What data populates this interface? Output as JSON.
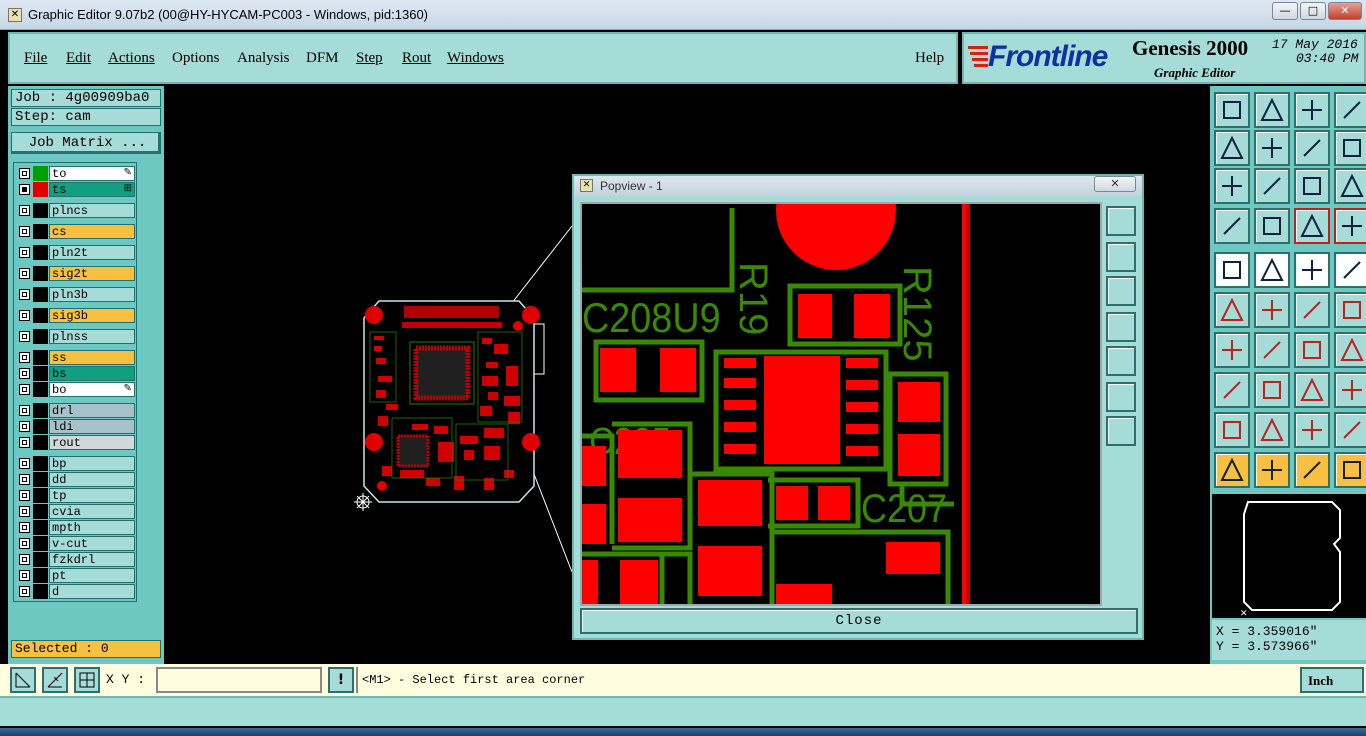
{
  "window": {
    "title": "Graphic Editor 9.07b2 (00@HY-HYCAM-PC003 - Windows, pid:1360)",
    "min": "—",
    "max": "□",
    "close": "✕"
  },
  "menu": [
    "File",
    "Edit",
    "Actions",
    "Options",
    "Analysis",
    "DFM",
    "Step",
    "Rout",
    "Windows"
  ],
  "help": "Help",
  "logo": {
    "brand": "Frontline",
    "product": "Genesis 2000",
    "sub": "Graphic Editor",
    "date": "17 May 2016",
    "time": "03:40 PM"
  },
  "job": {
    "job": "Job : 4g00909ba0",
    "step": "Step: cam",
    "matrix": "Job Matrix ..."
  },
  "layers": [
    {
      "name": "to",
      "color": "#00a000",
      "bg": "#ffffff",
      "checked": false,
      "mark": "✎"
    },
    {
      "name": "ts",
      "color": "#e00000",
      "bg": "#10a080",
      "checked": true,
      "mark": "⊞"
    },
    {
      "name": "plncs",
      "color": "#000000",
      "bg": "#a6dcd8",
      "checked": false,
      "mark": ""
    },
    {
      "name": "cs",
      "color": "#000000",
      "bg": "#f8c040",
      "checked": false,
      "mark": ""
    },
    {
      "name": "pln2t",
      "color": "#000000",
      "bg": "#a6dcd8",
      "checked": false,
      "mark": ""
    },
    {
      "name": "sig2t",
      "color": "#000000",
      "bg": "#f8c040",
      "checked": false,
      "mark": ""
    },
    {
      "name": "pln3b",
      "color": "#000000",
      "bg": "#a6dcd8",
      "checked": false,
      "mark": ""
    },
    {
      "name": "sig3b",
      "color": "#000000",
      "bg": "#f8c040",
      "checked": false,
      "mark": ""
    },
    {
      "name": "plnss",
      "color": "#000000",
      "bg": "#a6dcd8",
      "checked": false,
      "mark": ""
    },
    {
      "name": "ss",
      "color": "#000000",
      "bg": "#f8c040",
      "checked": false,
      "mark": ""
    },
    {
      "name": "bs",
      "color": "#000000",
      "bg": "#10a080",
      "checked": false,
      "mark": ""
    },
    {
      "name": "bo",
      "color": "#000000",
      "bg": "#ffffff",
      "checked": false,
      "mark": "✎"
    },
    {
      "name": "drl",
      "color": "#000000",
      "bg": "#a8c0c8",
      "checked": false,
      "mark": ""
    },
    {
      "name": "ldi",
      "color": "#000000",
      "bg": "#a8c0c8",
      "checked": false,
      "mark": ""
    },
    {
      "name": "rout",
      "color": "#000000",
      "bg": "#d0d8d8",
      "checked": false,
      "mark": ""
    },
    {
      "name": "bp",
      "color": "#000000",
      "bg": "#a6dcd8",
      "checked": false,
      "mark": ""
    },
    {
      "name": "dd",
      "color": "#000000",
      "bg": "#a6dcd8",
      "checked": false,
      "mark": ""
    },
    {
      "name": "tp",
      "color": "#000000",
      "bg": "#a6dcd8",
      "checked": false,
      "mark": ""
    },
    {
      "name": "cvia",
      "color": "#000000",
      "bg": "#a6dcd8",
      "checked": false,
      "mark": ""
    },
    {
      "name": "mpth",
      "color": "#000000",
      "bg": "#a6dcd8",
      "checked": false,
      "mark": ""
    },
    {
      "name": "v-cut",
      "color": "#000000",
      "bg": "#a6dcd8",
      "checked": false,
      "mark": ""
    },
    {
      "name": "fzkdrl",
      "color": "#000000",
      "bg": "#a6dcd8",
      "checked": false,
      "mark": ""
    },
    {
      "name": "pt",
      "color": "#000000",
      "bg": "#a6dcd8",
      "checked": false,
      "mark": ""
    },
    {
      "name": "d",
      "color": "#000000",
      "bg": "#a6dcd8",
      "checked": false,
      "mark": ""
    }
  ],
  "selected": "Selected : 0",
  "popview": {
    "title": "Popview - 1",
    "close_x": "✕",
    "close_btn": "Close",
    "labels": {
      "u9": "C208U9",
      "r19": "R19",
      "r125": "R125",
      "c205": "C205",
      "c207": "C207"
    }
  },
  "coords": {
    "x": "X = 3.359016\"",
    "y": "Y = 3.573966\""
  },
  "status": {
    "xy_label": "X Y :",
    "xy_value": "",
    "warn": "!",
    "message": "<M1> - Select first area corner",
    "units": "Inch"
  },
  "colors": {
    "panel": "#a6dcd8",
    "dark": "#6cc8c0",
    "pad": "#ff0000",
    "trace": "#3a8a00",
    "outline": "#ffffff"
  }
}
